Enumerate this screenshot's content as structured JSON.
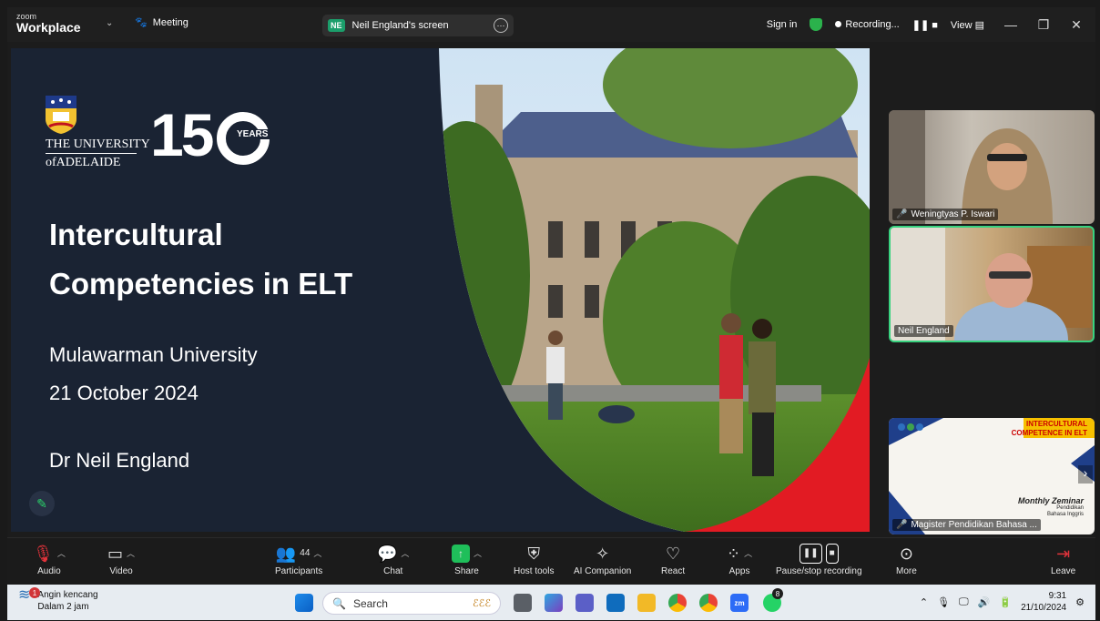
{
  "titlebar": {
    "logo_top": "zoom",
    "logo_main": "Workplace",
    "meeting_label": "Meeting",
    "share_initials": "NE",
    "share_label": "Neil England's screen",
    "sign_in": "Sign in",
    "recording": "Recording...",
    "view": "View"
  },
  "slide": {
    "university_line1": "THE UNIVERSITY",
    "university_line2": "ofADELAIDE",
    "anniversary": "15",
    "years_label": "YEARS",
    "title_line1": "Intercultural",
    "title_line2": "Competencies in ELT",
    "org": "Mulawarman University",
    "date": "21 October 2024",
    "presenter": "Dr Neil England"
  },
  "gallery": [
    {
      "name": "Weningtyas P. Iswari",
      "muted": true
    },
    {
      "name": "Neil England",
      "muted": false
    },
    {
      "name": "Magister Pendidikan Bahasa ...",
      "muted": true
    }
  ],
  "thumb3": {
    "heading_line1": "INTERCULTURAL",
    "heading_line2": "COMPETENCE IN ELT",
    "tagline": "Monthly Zeminar",
    "sub_line1": "Pendidikan",
    "sub_line2": "Bahasa Inggris"
  },
  "toolbar": {
    "audio": "Audio",
    "video": "Video",
    "participants": "Participants",
    "participants_count": "44",
    "chat": "Chat",
    "share": "Share",
    "host_tools": "Host tools",
    "ai": "AI Companion",
    "react": "React",
    "apps": "Apps",
    "recording": "Pause/stop recording",
    "more": "More",
    "leave": "Leave"
  },
  "taskbar": {
    "weather_line1": "Angin kencang",
    "weather_line2": "Dalam 2 jam",
    "weather_badge": "1",
    "search_placeholder": "Search",
    "whatsapp_badge": "8",
    "time": "9:31",
    "date": "21/10/2024"
  },
  "colors": {
    "slide_bg": "#1a2333",
    "accent_red": "#e21b23",
    "active_speaker": "#38d27f",
    "share_green": "#1fbf5a"
  }
}
